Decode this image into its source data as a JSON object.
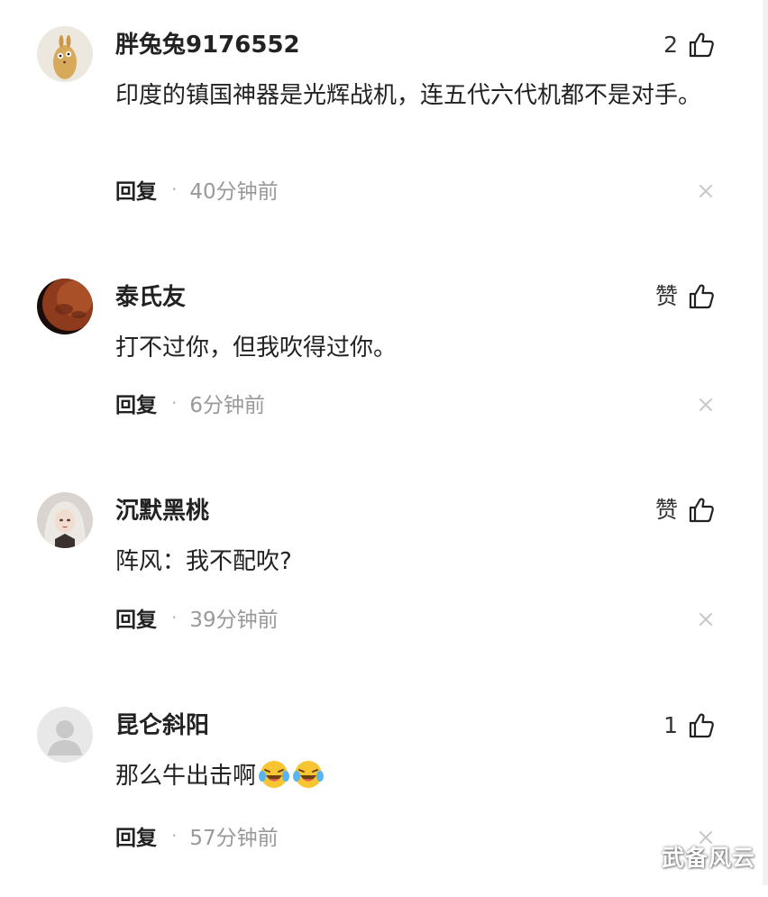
{
  "comments": [
    {
      "username": "胖兔兔9176552",
      "like_count": "2",
      "text": "印度的镇国神器是光辉战机，连五代六代机都不是对手。",
      "reply_label": "回复",
      "separator": "·",
      "time": "40分钟前"
    },
    {
      "username": "泰氏友",
      "like_count": "赞",
      "text": "打不过你，但我吹得过你。",
      "reply_label": "回复",
      "separator": "·",
      "time": "6分钟前"
    },
    {
      "username": "沉默黑桃",
      "like_count": "赞",
      "text": "阵风：我不配吹?",
      "reply_label": "回复",
      "separator": "·",
      "time": "39分钟前"
    },
    {
      "username": "昆仑斜阳",
      "like_count": "1",
      "text": "那么牛出击啊",
      "emoji_icons": [
        "laugh-cry-emoji",
        "laugh-cry-emoji"
      ],
      "reply_label": "回复",
      "separator": "·",
      "time": "57分钟前"
    }
  ],
  "watermark": "武备风云",
  "icons": {
    "like": "thumbs-up-icon",
    "dismiss": "close-icon"
  },
  "colors": {
    "text_primary": "#222222",
    "text_secondary": "#999999",
    "close_icon": "#c8c8c8"
  }
}
